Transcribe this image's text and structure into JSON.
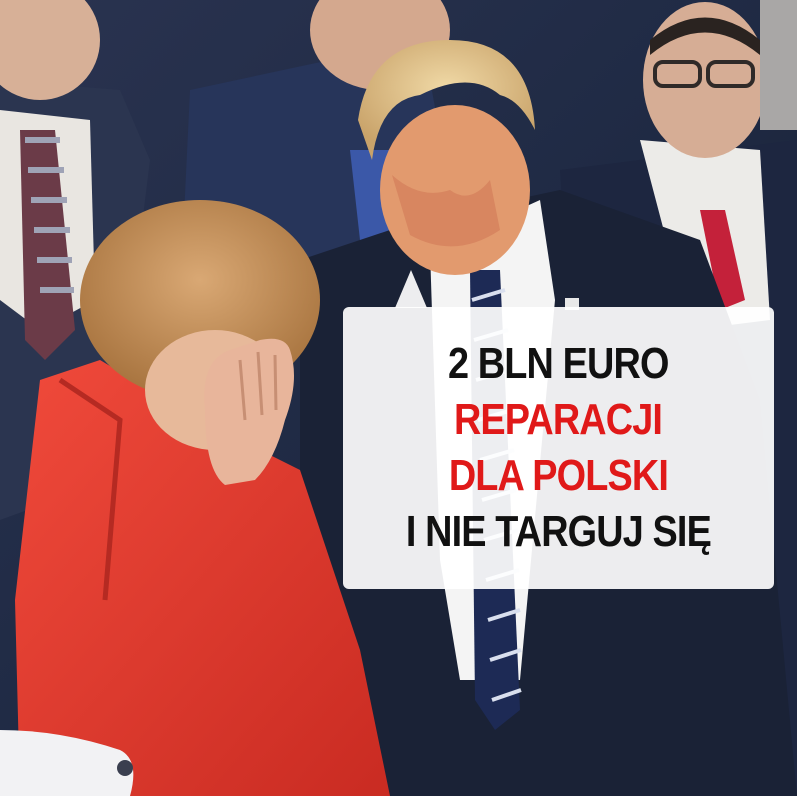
{
  "meme": {
    "speech_bubble": {
      "lines": [
        {
          "text": "2 BLN EURO",
          "color": "#111111"
        },
        {
          "text": "REPARACJI",
          "color": "#e01919"
        },
        {
          "text": "DLA POLSKI",
          "color": "#e01919"
        },
        {
          "text": "I NIE TARGUJ SIĘ",
          "color": "#111111"
        }
      ]
    },
    "colors": {
      "red_jacket": "#e63b2e",
      "dark_suit": "#1c2436",
      "bubble_fill": "#ffffff"
    }
  }
}
